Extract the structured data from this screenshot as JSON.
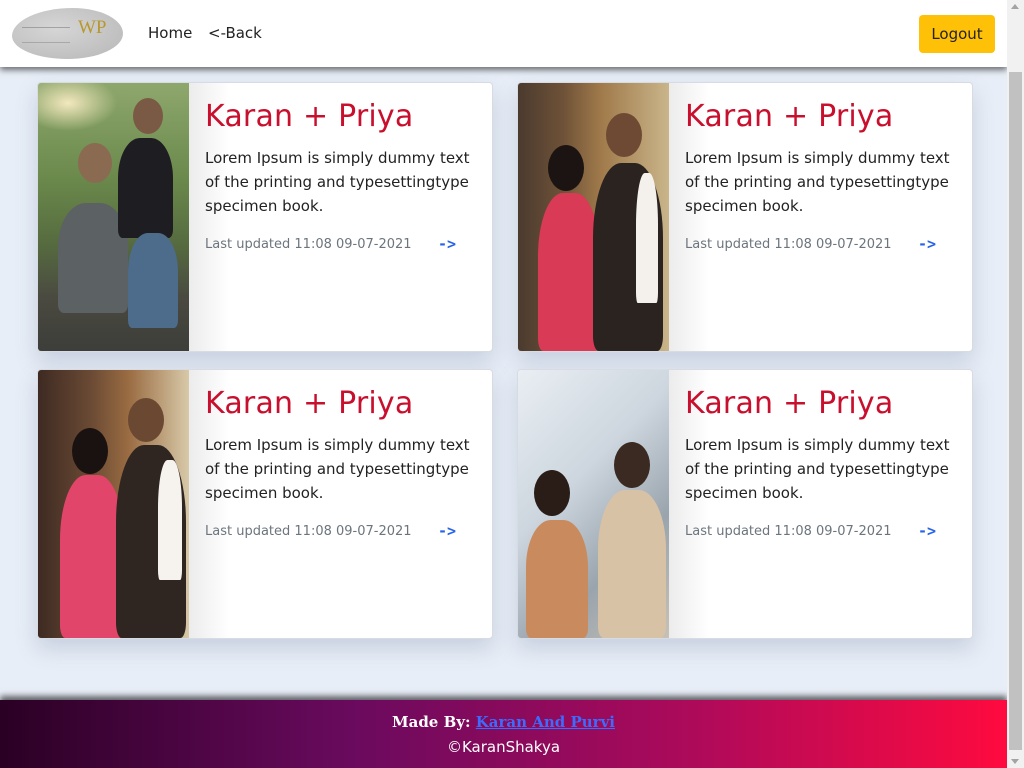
{
  "navbar": {
    "logo_text": "WP",
    "home_label": "Home",
    "back_label": "<-Back",
    "logout_label": "Logout"
  },
  "cards": [
    {
      "title": "Karan + Priya",
      "text": "Lorem Ipsum is simply dummy text of the printing and typesettingtype specimen book.",
      "updated": "Last updated 11:08 09-07-2021",
      "arrow": "->"
    },
    {
      "title": "Karan + Priya",
      "text": "Lorem Ipsum is simply dummy text of the printing and typesettingtype specimen book.",
      "updated": "Last updated 11:08 09-07-2021",
      "arrow": "->"
    },
    {
      "title": "Karan + Priya",
      "text": "Lorem Ipsum is simply dummy text of the printing and typesettingtype specimen book.",
      "updated": "Last updated 11:08 09-07-2021",
      "arrow": "->"
    },
    {
      "title": "Karan + Priya",
      "text": "Lorem Ipsum is simply dummy text of the printing and typesettingtype specimen book.",
      "updated": "Last updated 11:08 09-07-2021",
      "arrow": "->"
    }
  ],
  "footer": {
    "made_by_prefix": "Made By: ",
    "made_by_link": "Karan And Purvi",
    "copyright": "©KaranShakya"
  },
  "colors": {
    "accent_button": "#ffc107",
    "card_title": "#c8102e",
    "link": "#2563eb"
  }
}
